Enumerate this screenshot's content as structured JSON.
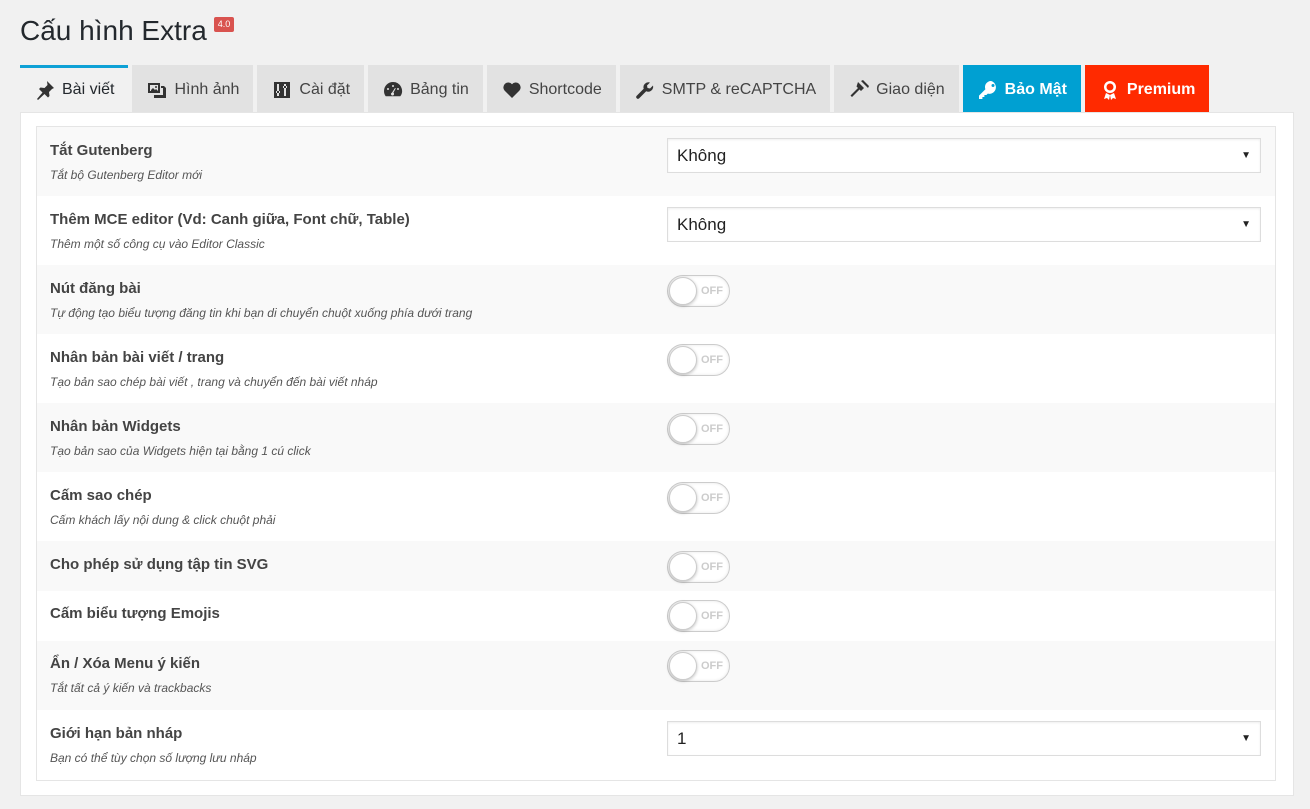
{
  "page": {
    "title": "Cấu hình Extra",
    "version": "4.0"
  },
  "tabs": [
    {
      "label": "Bài viết",
      "icon": "pushpin-icon"
    },
    {
      "label": "Hình ảnh",
      "icon": "images-icon"
    },
    {
      "label": "Cài đặt",
      "icon": "sliders-icon"
    },
    {
      "label": "Bảng tin",
      "icon": "dashboard-icon"
    },
    {
      "label": "Shortcode",
      "icon": "heart-icon"
    },
    {
      "label": "SMTP & reCAPTCHA",
      "icon": "wrench-icon"
    },
    {
      "label": "Giao diện",
      "icon": "hammer-icon"
    },
    {
      "label": "Bảo Mật",
      "icon": "key-icon"
    },
    {
      "label": "Premium",
      "icon": "award-icon"
    }
  ],
  "settings": [
    {
      "label": "Tắt Gutenberg",
      "desc": "Tắt bộ Gutenberg Editor mới",
      "control": "select",
      "value": "Không"
    },
    {
      "label": "Thêm MCE editor (Vd: Canh giữa, Font chữ, Table)",
      "desc": "Thêm một số công cụ vào Editor Classic",
      "control": "select",
      "value": "Không"
    },
    {
      "label": "Nút đăng bài",
      "desc": "Tự động tạo biểu tượng đăng tin khi bạn di chuyển chuột xuống phía dưới trang",
      "control": "toggle",
      "value": "OFF"
    },
    {
      "label": "Nhân bản bài viết / trang",
      "desc": "Tạo bản sao chép bài viết , trang và chuyển đến bài viết nháp",
      "control": "toggle",
      "value": "OFF"
    },
    {
      "label": "Nhân bản Widgets",
      "desc": "Tạo bản sao của Widgets hiện tại bằng 1 cú click",
      "control": "toggle",
      "value": "OFF"
    },
    {
      "label": "Cấm sao chép",
      "desc": "Cấm khách lấy nội dung & click chuột phải",
      "control": "toggle",
      "value": "OFF"
    },
    {
      "label": "Cho phép sử dụng tập tin SVG",
      "desc": "",
      "control": "toggle",
      "value": "OFF"
    },
    {
      "label": "Cấm biểu tượng Emojis",
      "desc": "",
      "control": "toggle",
      "value": "OFF"
    },
    {
      "label": "Ẩn / Xóa Menu ý kiến",
      "desc": "Tắt tất cả ý kiến và trackbacks",
      "control": "toggle",
      "value": "OFF"
    },
    {
      "label": "Giới hạn bản nháp",
      "desc": "Bạn có thể tùy chọn số lượng lưu nháp",
      "control": "select",
      "value": "1"
    }
  ],
  "colors": {
    "active_tab_border": "#0ea1d6",
    "security_tab": "#00a0d2",
    "premium_tab": "#ff2a00",
    "version_badge": "#d9534f"
  }
}
